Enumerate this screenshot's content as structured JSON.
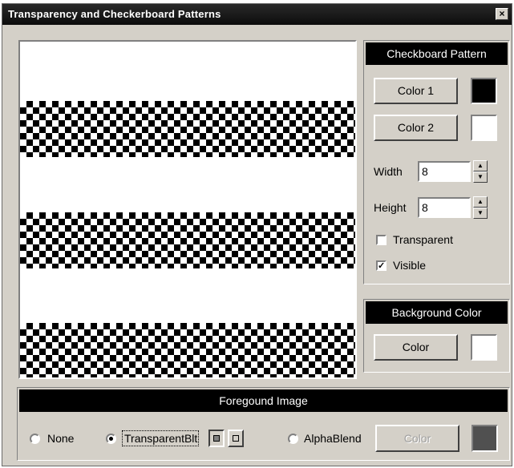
{
  "window": {
    "title": "Transparency and Checkerboard Patterns",
    "close_glyph": "×"
  },
  "preview": {
    "band_count": 3,
    "checker_colors": [
      "#000000",
      "#ffffff"
    ]
  },
  "checkerboard": {
    "header": "Checkboard Pattern",
    "color1_label": "Color 1",
    "color1_value": "#000000",
    "color2_label": "Color 2",
    "color2_value": "#ffffff",
    "width_label": "Width",
    "width_value": "8",
    "height_label": "Height",
    "height_value": "8",
    "transparent_label": "Transparent",
    "transparent_checked": false,
    "visible_label": "Visible",
    "visible_checked": true
  },
  "background": {
    "header": "Background Color",
    "color_label": "Color",
    "color_value": "#ffffff"
  },
  "foreground": {
    "header": "Foregound Image",
    "none_label": "None",
    "transparent_label": "TransparentBlt",
    "alphablend_label": "AlphaBlend",
    "color_label": "Color",
    "color_value": "#505050",
    "selected": "TransparentBlt"
  },
  "icons": {
    "spin_up": "▲",
    "spin_down": "▼",
    "check": "✓"
  }
}
